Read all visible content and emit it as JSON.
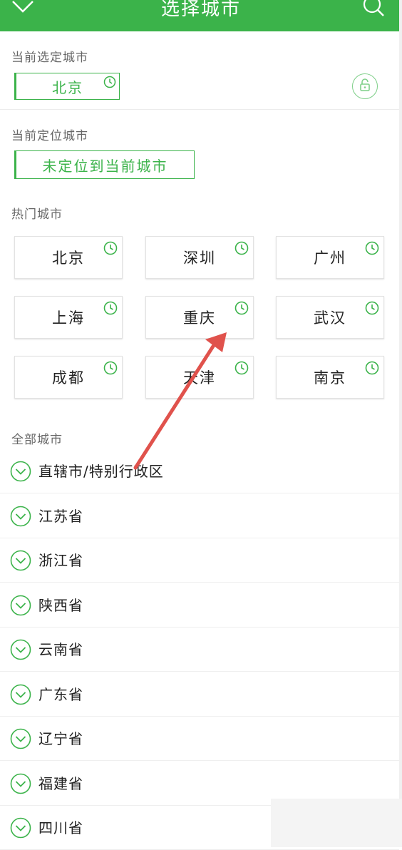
{
  "header": {
    "title": "选择城市",
    "bg_color": "#3bb34a"
  },
  "selected_city": {
    "label": "当前选定城市",
    "value": "北京"
  },
  "located_city": {
    "label": "当前定位城市",
    "value": "未定位到当前城市"
  },
  "hot_cities": {
    "label": "热门城市",
    "items": [
      "北京",
      "深圳",
      "广州",
      "上海",
      "重庆",
      "武汉",
      "成都",
      "天津",
      "南京"
    ]
  },
  "all_cities": {
    "label": "全部城市",
    "provinces": [
      "直辖市/特别行政区",
      "江苏省",
      "浙江省",
      "陕西省",
      "云南省",
      "广东省",
      "辽宁省",
      "福建省",
      "四川省"
    ]
  },
  "colors": {
    "accent": "#3bb34a",
    "annotation_arrow": "#e0524c"
  }
}
